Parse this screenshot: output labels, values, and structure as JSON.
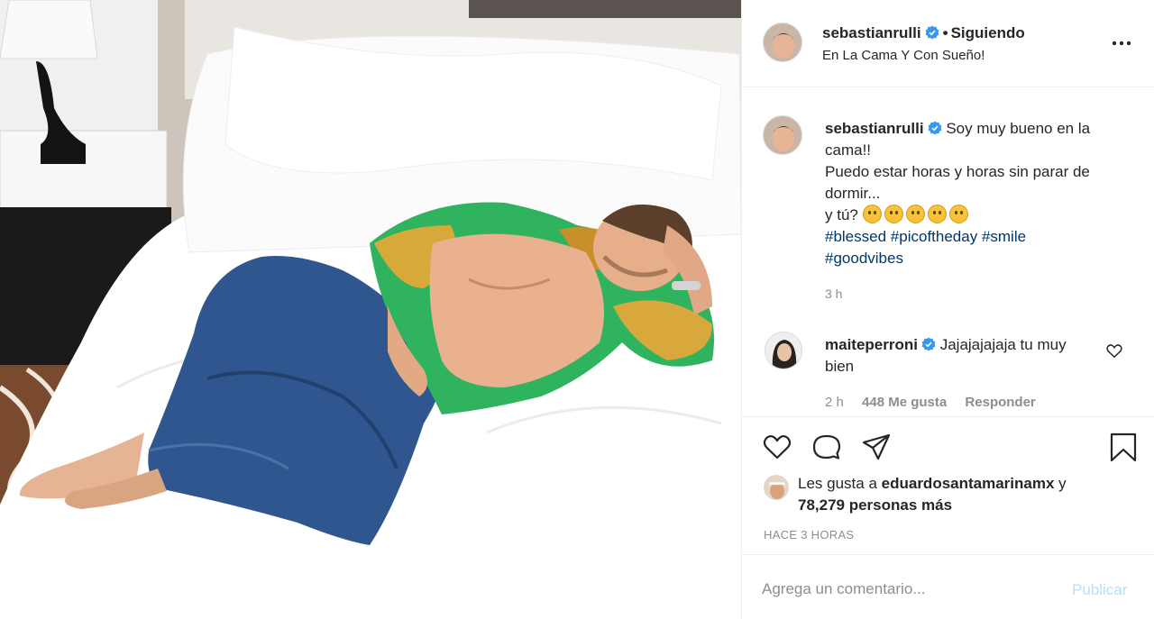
{
  "post": {
    "author": "sebastianrulli",
    "follow_sep": "•",
    "follow_status": "Siguiendo",
    "location": "En La Cama Y Con Sueño!",
    "more_icon": "more-horizontal-icon"
  },
  "caption": {
    "author": "sebastianrulli",
    "line1": "Soy muy bueno en la cama!!",
    "line2": "Puedo estar horas y horas sin parar de dormir...",
    "line3": "y tú?",
    "hashtags": [
      "#blessed",
      "#picoftheday",
      "#smile",
      "#goodvibes"
    ],
    "time": "3 h"
  },
  "comment": {
    "author": "maiteperroni",
    "text": "Jajajajajaja tu muy bien",
    "time": "2 h",
    "likes": "448 Me gusta",
    "reply": "Responder"
  },
  "actions": {
    "like_icon": "heart-icon",
    "comment_icon": "comment-icon",
    "share_icon": "send-icon",
    "save_icon": "bookmark-icon"
  },
  "likes": {
    "prefix": "Les gusta a",
    "user": "eduardosantamarinamx",
    "joiner": "y",
    "count": "78,279 personas más"
  },
  "timestamp": "HACE 3 HORAS",
  "add_comment": {
    "placeholder": "Agrega un comentario...",
    "publish": "Publicar"
  },
  "colors": {
    "verified": "#3897f0",
    "link": "#00376b",
    "secondary": "#8e8e8e",
    "publish_disabled": "#b2dffc"
  }
}
